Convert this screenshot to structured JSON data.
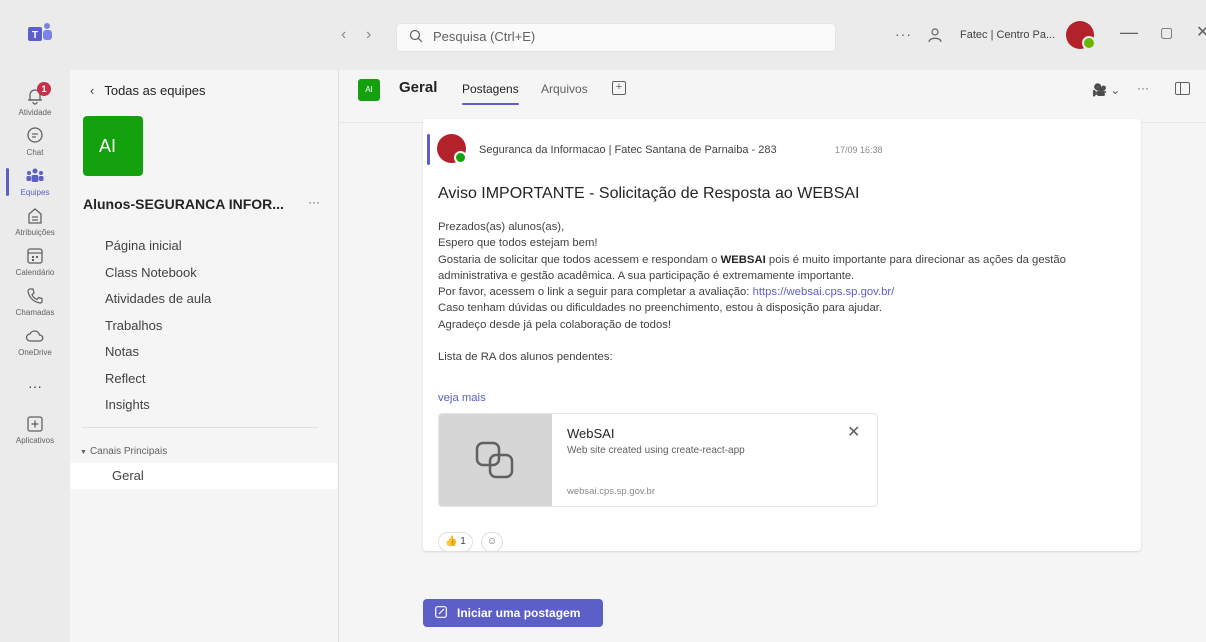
{
  "titlebar": {
    "search_placeholder": "Pesquisa (Ctrl+E)",
    "more": "···",
    "org": "Fatec | Centro Pa...",
    "minimize": "—",
    "maximize": "▢",
    "close": "✕"
  },
  "rail": {
    "items": [
      {
        "label": "Atividade",
        "icon": "bell-icon",
        "badge": "1"
      },
      {
        "label": "Chat",
        "icon": "chat-icon"
      },
      {
        "label": "Equipes",
        "icon": "teams-icon",
        "active": true
      },
      {
        "label": "Atribuições",
        "icon": "assignments-icon"
      },
      {
        "label": "Calendário",
        "icon": "calendar-icon"
      },
      {
        "label": "Chamadas",
        "icon": "phone-icon"
      },
      {
        "label": "OneDrive",
        "icon": "cloud-icon"
      },
      {
        "label": "···",
        "icon": "more-icon"
      },
      {
        "label": "Aplicativos",
        "icon": "apps-icon"
      }
    ]
  },
  "sidebar": {
    "back_label": "Todas as equipes",
    "team_initials": "AI",
    "team_name": "Alunos-SEGURANCA INFOR...",
    "team_more": "···",
    "menu": [
      "Página inicial",
      "Class Notebook",
      "Atividades de aula",
      "Trabalhos",
      "Notas",
      "Reflect",
      "Insights"
    ],
    "channels_heading": "Canais Principais",
    "channel": "Geral"
  },
  "header": {
    "channel_initials": "AI",
    "channel_name": "Geral",
    "tabs": [
      "Postagens",
      "Arquivos"
    ],
    "video_label": "🎥 ⌄",
    "more": "···"
  },
  "post": {
    "author": "Seguranca da Informacao | Fatec Santana de Parnaiba - 283",
    "time": "17/09 16:38",
    "title": "Aviso IMPORTANTE - Solicitação de Resposta ao WEBSAI",
    "greeting": "Prezados(as) alunos(as),",
    "line2": "Espero que todos estejam bem!",
    "line3_a": "Gostaria de solicitar que todos acessem e respondam o ",
    "line3_bold": "WEBSAI",
    "line3_b": " pois é muito importante para direcionar as ações da gestão administrativa e gestão acadêmica. A sua participação é extremamente importante.",
    "line4_a": "Por favor, acessem o link a seguir para completar a avaliação: ",
    "line4_link": "https://websai.cps.sp.gov.br/",
    "line5": "Caso tenham dúvidas ou dificuldades no preenchimento, estou à disposição para ajudar.",
    "line6": "Agradeço desde já pela colaboração de todos!",
    "line7": "Lista de RA dos alunos pendentes:",
    "see_more": "veja mais",
    "link_card": {
      "title": "WebSAI",
      "description": "Web site created using create-react-app",
      "url": "websai.cps.sp.gov.br"
    },
    "reaction_count": "1"
  },
  "new_post_label": "Iniciar uma postagem",
  "colors": {
    "accent": "#5b5fc7",
    "team_green": "#13a10e",
    "badge_red": "#c4314b",
    "avatar_red": "#b3222b"
  }
}
